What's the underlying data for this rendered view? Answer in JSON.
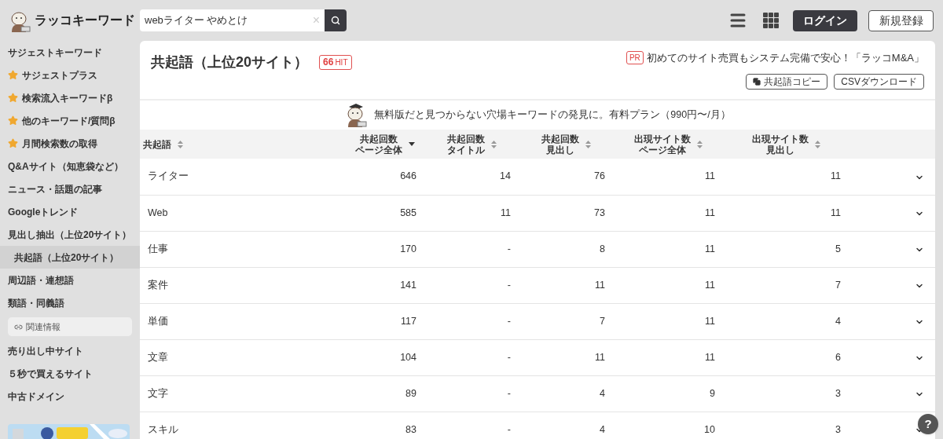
{
  "header": {
    "logo_text": "ラッコキーワード",
    "search": {
      "value": "webライター やめとけ",
      "clear": "×"
    },
    "login": "ログイン",
    "signup": "新規登録"
  },
  "sidebar": {
    "items": [
      {
        "label": "サジェストキーワード",
        "kind": "plain",
        "selected": false
      },
      {
        "label": "サジェストプラス",
        "kind": "star",
        "selected": false
      },
      {
        "label": "検索流入キーワードβ",
        "kind": "star",
        "selected": false
      },
      {
        "label": "他のキーワード/質問β",
        "kind": "star",
        "selected": false
      },
      {
        "label": "月間検索数の取得",
        "kind": "star",
        "selected": false
      },
      {
        "label": "Q&Aサイト（知恵袋など）",
        "kind": "plain",
        "selected": false
      },
      {
        "label": "ニュース・話題の記事",
        "kind": "plain",
        "selected": false
      },
      {
        "label": "Googleトレンド",
        "kind": "plain",
        "selected": false
      },
      {
        "label": "見出し抽出（上位20サイト）",
        "kind": "plain",
        "selected": false
      },
      {
        "label": "共起語（上位20サイト）",
        "kind": "plain",
        "selected": true
      },
      {
        "label": "周辺語・連想語",
        "kind": "plain",
        "selected": false
      },
      {
        "label": "類語・同義語",
        "kind": "plain",
        "selected": false
      },
      {
        "label": "関連情報",
        "kind": "section"
      },
      {
        "label": "売り出し中サイト",
        "kind": "plain",
        "selected": false
      },
      {
        "label": "５秒で買えるサイト",
        "kind": "plain",
        "selected": false
      },
      {
        "label": "中古ドメイン",
        "kind": "plain",
        "selected": false
      }
    ]
  },
  "main": {
    "title": "共起語（上位20サイト）",
    "hit_count": "66",
    "hit_label": "HIT",
    "pr_badge": "PR",
    "pr_text": "初めてのサイト売買もシステム完備で安心！「ラッコM&A」",
    "buttons": [
      "共起語コピー",
      "CSVダウンロード"
    ],
    "promo": "無料版だと見つからない穴場キーワードの発見に。有料プラン（990円〜/月）",
    "table": {
      "columns": [
        {
          "lines": [
            "共起語"
          ],
          "sorted": false
        },
        {
          "lines": [
            "共起回数",
            "ページ全体"
          ],
          "sorted": true
        },
        {
          "lines": [
            "共起回数",
            "タイトル"
          ],
          "sorted": false
        },
        {
          "lines": [
            "共起回数",
            "見出し"
          ],
          "sorted": false
        },
        {
          "lines": [
            "出現サイト数",
            "ページ全体"
          ],
          "sorted": false
        },
        {
          "lines": [
            "出現サイト数",
            "見出し"
          ],
          "sorted": false
        }
      ],
      "rows": [
        [
          "ライター",
          "646",
          "14",
          "76",
          "11",
          "11"
        ],
        [
          "Web",
          "585",
          "11",
          "73",
          "11",
          "11"
        ],
        [
          "仕事",
          "170",
          "-",
          "8",
          "11",
          "5"
        ],
        [
          "案件",
          "141",
          "-",
          "11",
          "11",
          "7"
        ],
        [
          "単価",
          "117",
          "-",
          "7",
          "11",
          "4"
        ],
        [
          "文章",
          "104",
          "-",
          "11",
          "11",
          "6"
        ],
        [
          "文字",
          "89",
          "-",
          "4",
          "9",
          "3"
        ],
        [
          "スキル",
          "83",
          "-",
          "4",
          "10",
          "3"
        ]
      ]
    }
  },
  "help_button": "?"
}
